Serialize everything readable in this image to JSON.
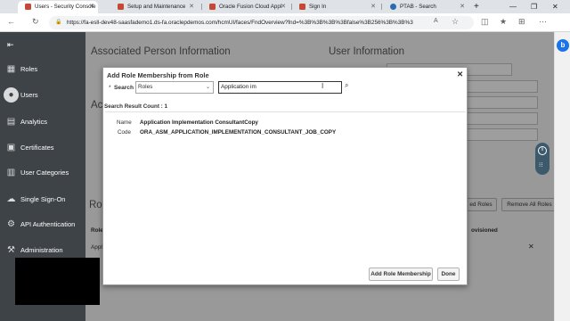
{
  "browser": {
    "tabs": [
      {
        "label": "Users - Security Console",
        "favicon_color": "#c74634",
        "active": true
      },
      {
        "label": "Setup and Maintenance",
        "favicon_color": "#c74634",
        "active": false
      },
      {
        "label": "Oracle Fusion Cloud Appl",
        "favicon_color": "#c74634",
        "active": false
      },
      {
        "label": "Sign In",
        "favicon_color": "#c74634",
        "active": false
      },
      {
        "label": "PTAB - Search",
        "favicon_color": "#2b6cb0",
        "active": false
      }
    ],
    "new_tab": "+",
    "url": "https://fa-esll-dev48-saasfademo1.ds-fa.oraclepdemos.com/hcmUI/faces/FndOverview?fnd=%3B%3B%3B%3Bfalse%3B256%3B%3B%3",
    "profile_initial": "b"
  },
  "sidenav": {
    "items": [
      {
        "label": "Roles",
        "icon": "roles-icon",
        "glyph": "▦"
      },
      {
        "label": "Users",
        "icon": "users-icon",
        "glyph": "●"
      },
      {
        "label": "Analytics",
        "icon": "analytics-icon",
        "glyph": "▤"
      },
      {
        "label": "Certificates",
        "icon": "certificates-icon",
        "glyph": "▣"
      },
      {
        "label": "User Categories",
        "icon": "user-categories-icon",
        "glyph": "▥"
      },
      {
        "label": "Single Sign-On",
        "icon": "cloud-icon",
        "glyph": "☁"
      },
      {
        "label": "API Authentication",
        "icon": "api-icon",
        "glyph": "⚙"
      },
      {
        "label": "Administration",
        "icon": "administration-icon",
        "glyph": "⚒"
      }
    ]
  },
  "background": {
    "associated_person": "Associated Person Information",
    "user_info": "User Information",
    "ac_partial": "Ac",
    "roles_partial": "Ro",
    "role_col_partial": "Role",
    "appl_partial": "Appl",
    "provisioned_partial": "ovisioned",
    "add_roles_partial": "ed Roles",
    "remove_all_roles": "Remove All Roles"
  },
  "dialog": {
    "title": "Add Role Membership from Role",
    "required_marker": "*",
    "search_label": "Search",
    "search_type": "Roles",
    "search_value": "Application im",
    "result_count": "Search Result Count : 1",
    "result": {
      "name_label": "Name",
      "name_value": "Application Implementation ConsultantCopy",
      "code_label": "Code",
      "code_value": "ORA_ASM_APPLICATION_IMPLEMENTATION_CONSULTANT_JOB_COPY"
    },
    "add_button": "Add Role Membership",
    "done_button": "Done"
  }
}
